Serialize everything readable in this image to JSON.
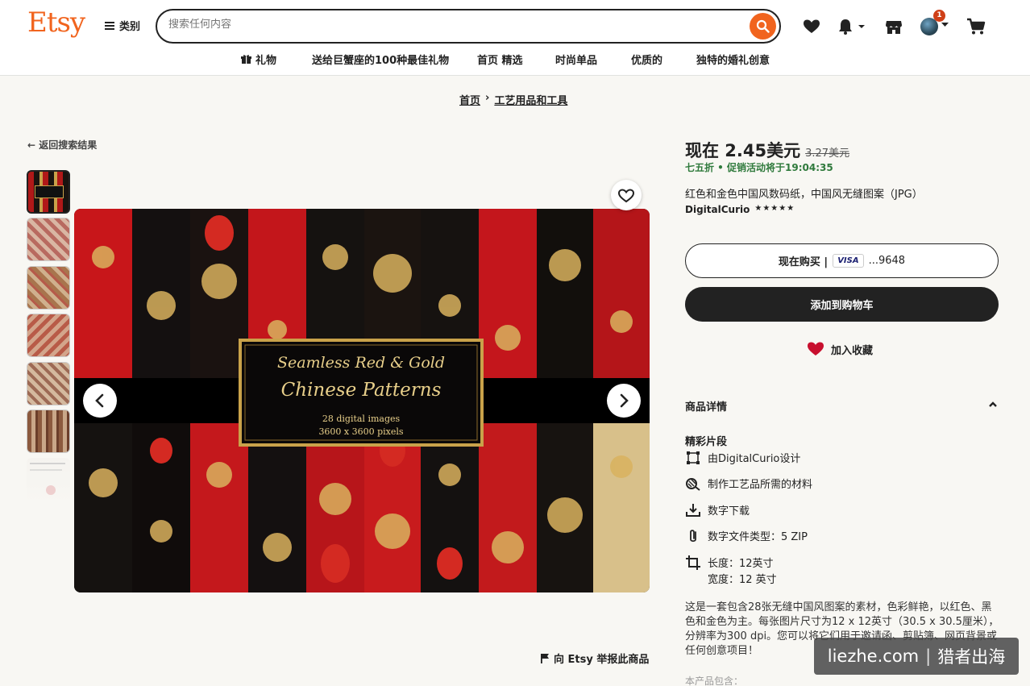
{
  "header": {
    "logo": "Etsy",
    "categories_label": "类别",
    "search_placeholder": "搜索任何内容",
    "cart_badge": "1"
  },
  "nav": [
    {
      "label": "礼物"
    },
    {
      "label": "送给巨蟹座的100种最佳礼物"
    },
    {
      "label": "首页 精选"
    },
    {
      "label": "时尚单品"
    },
    {
      "label": "优质的"
    },
    {
      "label": "独特的婚礼创意"
    }
  ],
  "breadcrumb": {
    "home": "首页",
    "sep": "›",
    "category": "工艺用品和工具"
  },
  "back_link": "返回搜索结果",
  "image_overlay": {
    "line1": "Seamless Red & Gold",
    "line2": "Chinese Patterns",
    "line3": "28 digital images",
    "line4": "3600 x 3600 pixels"
  },
  "report_link": "向 Etsy 举报此商品",
  "product": {
    "price_now": "现在 2.45美元",
    "price_old": "3.27美元",
    "sale_text": "七五折 • 促销活动将于19:04:35",
    "title": "红色和金色中国风数码纸，中国风无缝图案（JPG）",
    "shop": "DigitalCurio",
    "stars": "★★★★★",
    "buy_now": "现在购买 |",
    "card_brand": "VISA",
    "card_last4": "...9648",
    "add_to_cart": "添加到购物车",
    "add_favorite": "加入收藏"
  },
  "details": {
    "section_title": "商品详情",
    "highlights_title": "精彩片段",
    "items": [
      {
        "text": "由DigitalCurio设计",
        "icon": "designer-icon"
      },
      {
        "text": "制作工艺品所需的材料",
        "icon": "craft-icon"
      },
      {
        "text": "数字下载",
        "icon": "download-icon"
      },
      {
        "text": "数字文件类型：5 ZIP",
        "icon": "paperclip-icon"
      },
      {
        "text": "长度：12英寸",
        "text2": "宽度：12 英寸",
        "icon": "dimensions-icon"
      }
    ],
    "description": "这是一套包含28张无缝中国风图案的素材，色彩鲜艳，以红色、黑色和金色为主。每张图片尺寸为12 x 12英寸（30.5 x 30.5厘米），分辨率为300 dpi。您可以将它们用于邀请函、剪贴簿、网页背景或任何创意项目！",
    "more_label": "本产品包含："
  },
  "watermark": {
    "site": "liezhe.com",
    "sep": "|",
    "name": "猎者出海"
  },
  "colors": {
    "brand": "#f1641e",
    "sale": "#2f7a3c",
    "dark": "#222222"
  }
}
